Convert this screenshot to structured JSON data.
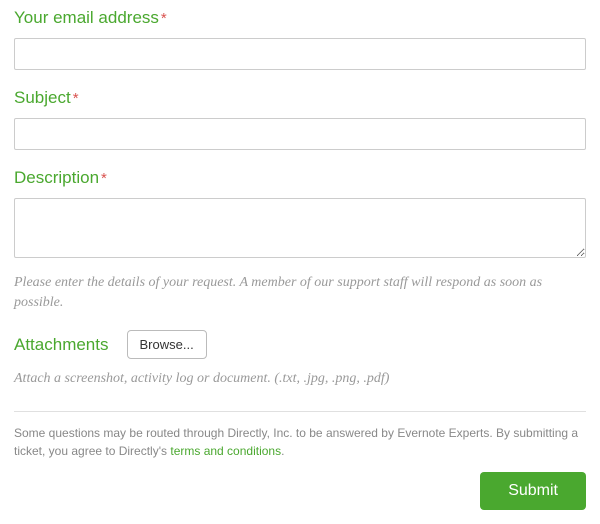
{
  "email": {
    "label": "Your email address",
    "required": "*"
  },
  "subject": {
    "label": "Subject",
    "required": "*"
  },
  "description": {
    "label": "Description",
    "required": "*",
    "hint": "Please enter the details of your request. A member of our support staff will respond as soon as possible."
  },
  "attachments": {
    "label": "Attachments",
    "browse": "Browse...",
    "hint": "Attach a screenshot, activity log or document. (.txt, .jpg, .png, .pdf)"
  },
  "footer": {
    "text_before": "Some questions may be routed through Directly, Inc. to be answered by Evernote Experts. By submitting a ticket, you agree to Directly's ",
    "link": "terms and conditions",
    "text_after": "."
  },
  "submit": "Submit"
}
